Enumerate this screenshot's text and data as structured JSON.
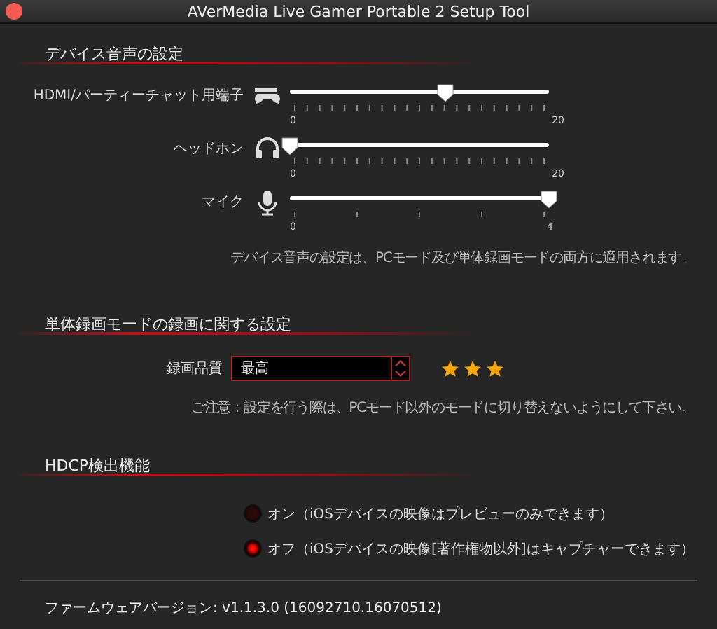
{
  "window": {
    "title": "AVerMedia Live Gamer Portable 2 Setup Tool"
  },
  "audio": {
    "heading": "デバイス音声の設定",
    "sliders": [
      {
        "label": "HDMI/パーティーチャット用端子",
        "level": 0.6,
        "min": "0",
        "max": "20"
      },
      {
        "label": "ヘッドホン",
        "level": 0,
        "min": "0",
        "max": "20"
      },
      {
        "label": "マイク",
        "level": 1,
        "min": "0",
        "max": "4"
      }
    ],
    "note": "デバイス音声の設定は、PCモード及び単体録画モードの両方に適用されます。"
  },
  "recording": {
    "heading": "単体録画モードの録画に関する設定",
    "quality_label": "録画品質",
    "quality": {
      "value": "最高"
    },
    "stars": 3,
    "note": "ご注意：設定を行う際は、PCモード以外のモードに切り替えないようにして下さい。"
  },
  "hdcp": {
    "heading": "HDCP検出機能",
    "options": [
      {
        "label": "オン（iOSデバイスの映像はプレビューのみできます）",
        "selected": false
      },
      {
        "label": "オフ（iOSデバイスの映像[著作権物以外]はキャプチャーできます）",
        "selected": true
      }
    ]
  },
  "firmware": "ファームウェアバージョン: v1.1.3.0 (16092710.16070512)"
}
